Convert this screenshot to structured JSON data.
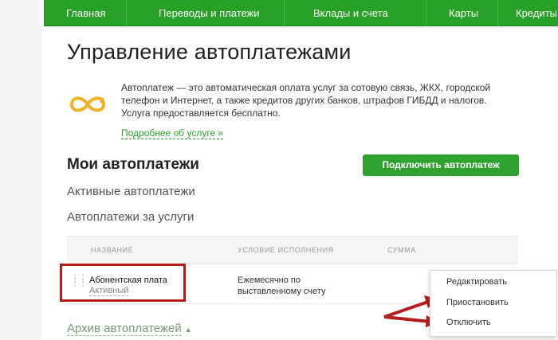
{
  "nav": {
    "items": [
      "Главная",
      "Переводы и платежи",
      "Вклады и счета",
      "Карты",
      "Кредиты"
    ]
  },
  "page_title": "Управление автоплатежами",
  "info": {
    "icon": "infinity-icon",
    "text": "Автоплатеж — это автоматическая оплата услуг за сотовую связь, ЖКХ, городской телефон и Интернет, а также кредитов других банков, штрафов ГИБДД и налогов. Услуга предоставляется бесплатно.",
    "link": "Подробнее об услуге »"
  },
  "my_section": {
    "title": "Мои автоплатежи",
    "connect_button": "Подключить автоплатеж",
    "active_title": "Активные автоплатежи",
    "services_title": "Автоплатежи за услуги"
  },
  "table": {
    "headers": [
      "НАЗВАНИЕ",
      "УСЛОВИЕ ИСПОЛНЕНИЯ",
      "СУММА"
    ],
    "rows": [
      {
        "name": "Абонентская плата",
        "status": "Активный",
        "condition": "Ежемесячно по выставленному счету"
      }
    ]
  },
  "archive": {
    "label": "Архив автоплатежей"
  },
  "menu": {
    "items": [
      "Редактировать",
      "Приостановить",
      "Отключить"
    ]
  },
  "colors": {
    "nav_bg": "#27a127",
    "accent": "#2ea12e",
    "icon_gold": "#f0b323",
    "annotation_red": "#b71c1c"
  }
}
